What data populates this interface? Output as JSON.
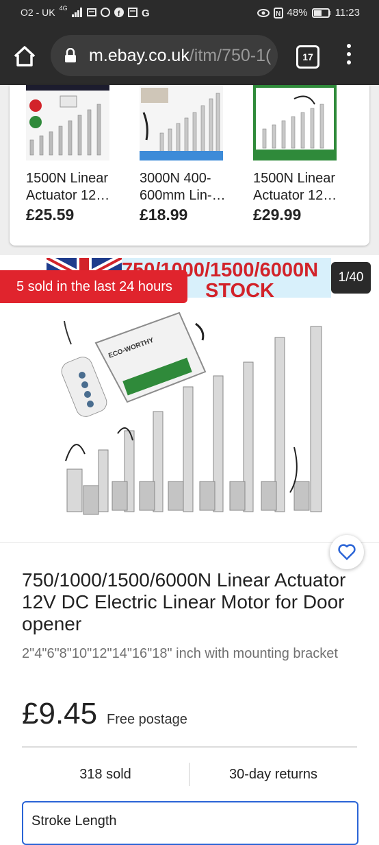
{
  "status_bar": {
    "carrier": "O2 - UK",
    "network": "4G",
    "battery": "48%",
    "time": "11:23"
  },
  "browser": {
    "url_domain": "m.ebay.co.uk",
    "url_path": "/itm/750-1(",
    "tab_count": "17"
  },
  "carousel": {
    "items": [
      {
        "title": "1500N Linear Actuator 12…",
        "price": "£25.59"
      },
      {
        "title": "3000N 400-600mm Lin-…",
        "price": "£18.99"
      },
      {
        "title": "1500N Linear Actuator 12…",
        "price": "£29.99"
      }
    ]
  },
  "gallery": {
    "banner_line1": "750/1000/1500/6000N",
    "banner_line2": "STOCK",
    "sold_badge": "5 sold in the last 24 hours",
    "counter": "1/40",
    "brand_label": "ECO-WORTHY"
  },
  "product": {
    "title": "750/1000/1500/6000N Linear Actuator 12V DC Electric Linear Motor for Door opener",
    "subtitle": "2\"4\"6\"8\"10\"12\"14\"16\"18\" inch with mounting bracket",
    "price": "£9.45",
    "postage": "Free postage",
    "sold": "318 sold",
    "returns": "30-day returns",
    "variation_label": "Stroke Length"
  },
  "colors": {
    "accent_red": "#e0242d",
    "link_blue": "#2a64d6",
    "toolbar": "#2b2b2b"
  }
}
